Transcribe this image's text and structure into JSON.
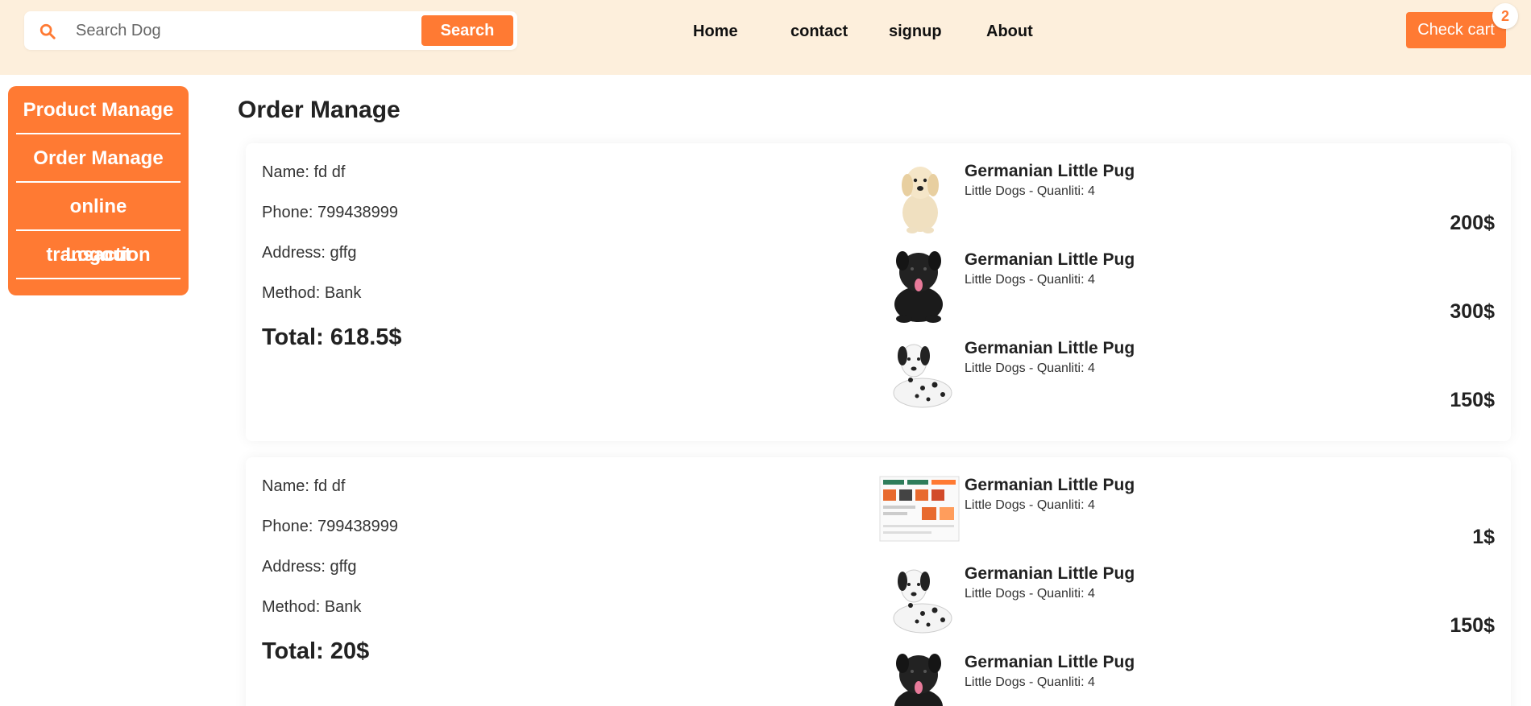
{
  "header": {
    "search_placeholder": "Search Dog",
    "search_button": "Search",
    "nav": {
      "home": "Home",
      "contact": "contact",
      "signup": "signup",
      "about": "About"
    },
    "cart_button": "Check cart",
    "cart_count": "2"
  },
  "sidebar": {
    "items": [
      {
        "label": "Product Manage"
      },
      {
        "label": "Order Manage"
      },
      {
        "label": "online transaction"
      },
      {
        "label": "Logout"
      }
    ]
  },
  "main": {
    "title": "Order Manage",
    "orders": [
      {
        "name": "Name: fd df",
        "phone": "Phone: 799438999",
        "address": "Address: gffg",
        "method": "Method: Bank",
        "total": "Total: 618.5$",
        "items": [
          {
            "name": "Germanian Little Pug",
            "sub": "Little Dogs - Quanliti: 4",
            "price": "200$",
            "image": "golden-retriever-puppy"
          },
          {
            "name": "Germanian Little Pug",
            "sub": "Little Dogs - Quanliti: 4",
            "price": "300$",
            "image": "black-terrier"
          },
          {
            "name": "Germanian Little Pug",
            "sub": "Little Dogs - Quanliti: 4",
            "price": "150$",
            "image": "dalmatian"
          }
        ]
      },
      {
        "name": "Name: fd df",
        "phone": "Phone: 799438999",
        "address": "Address: gffg",
        "method": "Method: Bank",
        "total": "Total: 20$",
        "items": [
          {
            "name": "Germanian Little Pug",
            "sub": "Little Dogs - Quanliti: 4",
            "price": "1$",
            "image": "website-screenshot"
          },
          {
            "name": "Germanian Little Pug",
            "sub": "Little Dogs - Quanliti: 4",
            "price": "150$",
            "image": "dalmatian"
          },
          {
            "name": "Germanian Little Pug",
            "sub": "Little Dogs - Quanliti: 4",
            "price": "",
            "image": "black-terrier"
          }
        ]
      }
    ]
  },
  "colors": {
    "accent": "#ff7a33",
    "header_bg": "#fdefdc"
  }
}
